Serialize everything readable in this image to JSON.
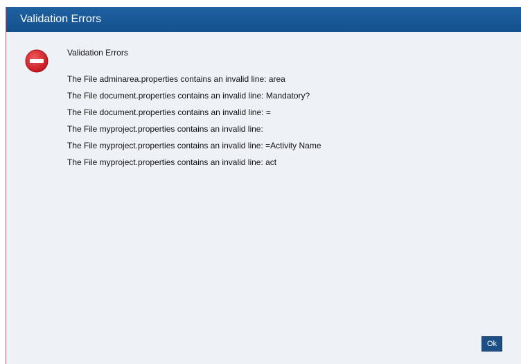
{
  "dialog": {
    "title": "Validation Errors",
    "heading": "Validation Errors",
    "icon": "error-stop-icon",
    "errors": [
      "The File adminarea.properties contains an invalid line: area",
      "The File document.properties contains an invalid line: Mandatory?",
      "The File document.properties contains an invalid line: =",
      "The File myproject.properties contains an invalid line:",
      "The File myproject.properties contains an invalid line: =Activity Name",
      "The File myproject.properties contains an invalid line: act"
    ],
    "ok_label": "Ok"
  },
  "colors": {
    "titlebar": "#1a5a9a",
    "body": "#eef2f7",
    "error_icon": "#d9232d",
    "button": "#1b4f86"
  }
}
